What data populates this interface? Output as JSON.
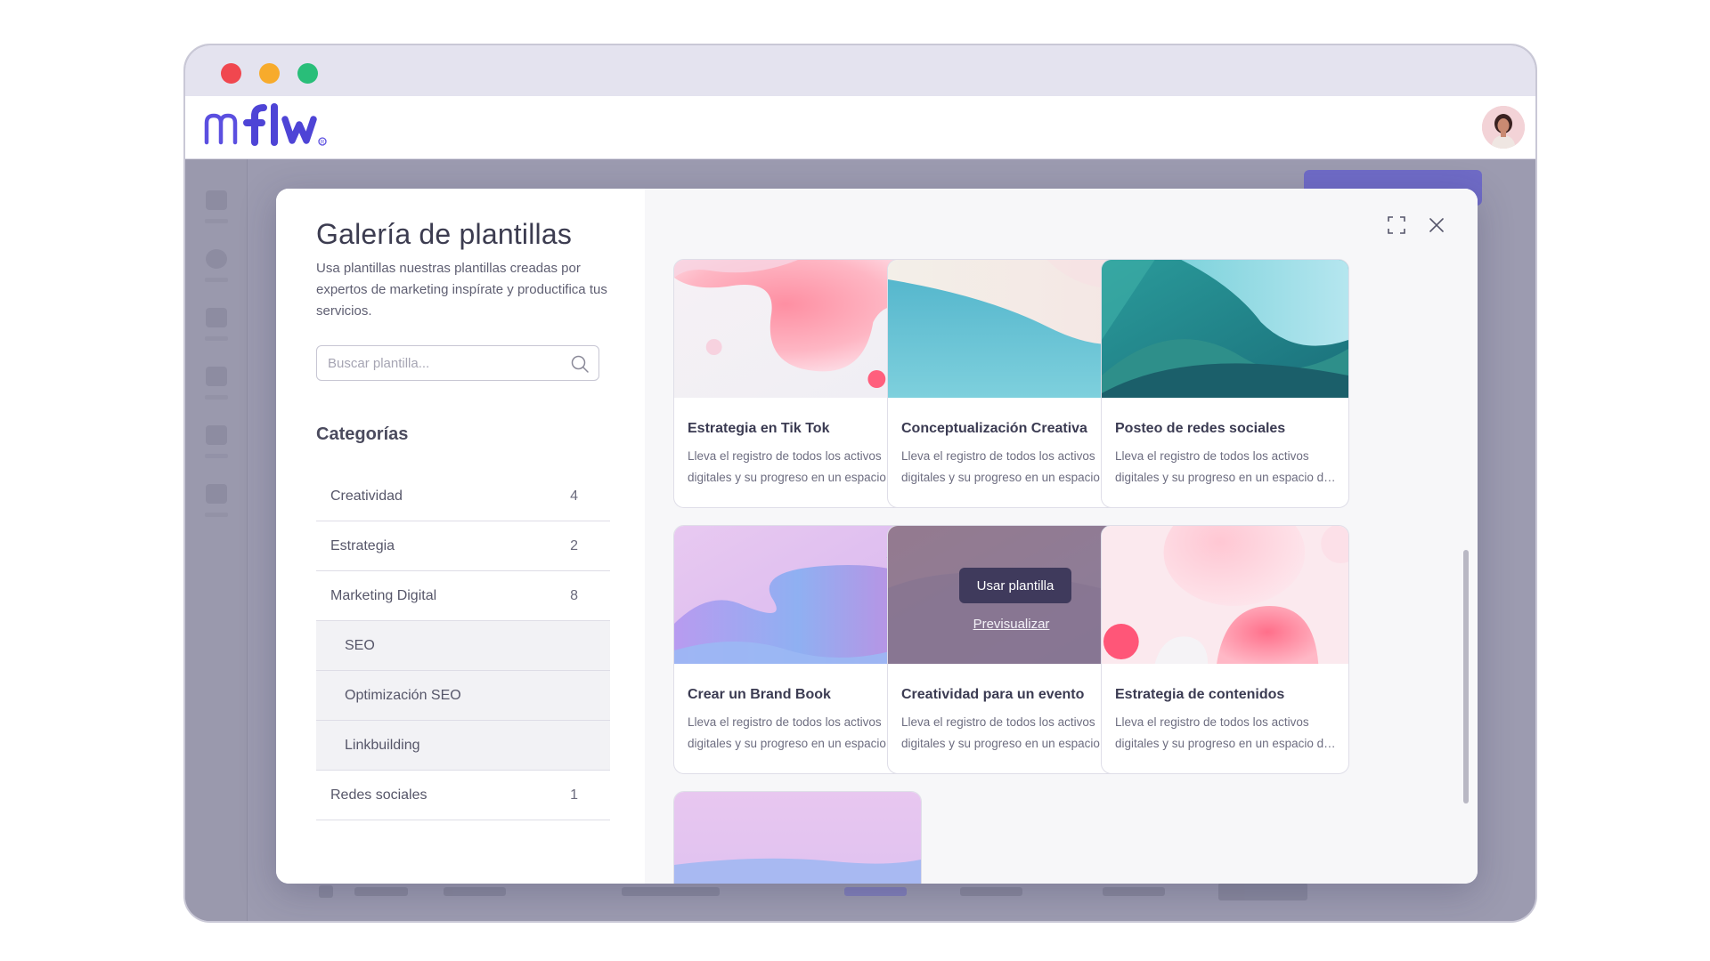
{
  "window": {
    "controls": [
      "close",
      "minimize",
      "maximize"
    ]
  },
  "app": {
    "logo_text": "mflw"
  },
  "gallery": {
    "title": "Galería de plantillas",
    "description": "Usa plantillas nuestras plantillas creadas por expertos de marketing inspírate y productifica tus servicios.",
    "search_placeholder": "Buscar plantilla..."
  },
  "categories": {
    "title": "Categorías",
    "items": [
      {
        "label": "Creatividad",
        "count": "4"
      },
      {
        "label": "Estrategia",
        "count": "2"
      },
      {
        "label": "Marketing Digital",
        "count": "8"
      },
      {
        "label": "SEO",
        "count": ""
      },
      {
        "label": "Optimización SEO",
        "count": ""
      },
      {
        "label": "Linkbuilding",
        "count": ""
      },
      {
        "label": "Redes sociales",
        "count": "1"
      }
    ]
  },
  "templates": [
    {
      "title": "Estrategia en Tik Tok",
      "desc1": "Lleva el registro de todos los activos",
      "desc2": "digitales y su progreso en un espacio de trabajo"
    },
    {
      "title": "Conceptualización Creativa",
      "desc1": "Lleva el registro de todos los activos",
      "desc2": "digitales y su progreso en un espacio de trabajo"
    },
    {
      "title": "Posteo de redes sociales",
      "desc1": "Lleva el registro de todos los activos",
      "desc2": "digitales y su progreso en un espacio de trabajo"
    },
    {
      "title": "Crear un Brand Book",
      "desc1": "Lleva el registro de todos los activos",
      "desc2": "digitales y su progreso en un espacio de trabajo"
    },
    {
      "title": "Creatividad para un evento",
      "desc1": "Lleva el registro de todos los activos",
      "desc2": "digitales y su progreso en un espacio de trabajo"
    },
    {
      "title": "Estrategia de contenidos",
      "desc1": "Lleva el registro de todos los activos",
      "desc2": "digitales y su progreso en un espacio de trabajo"
    }
  ],
  "card_actions": {
    "use": "Usar plantilla",
    "preview": "Previsualizar"
  },
  "colors": {
    "brand": "#5b4fe0",
    "primary_dark": "#3f3a5c",
    "background_overlay": "#9d9cb0"
  }
}
